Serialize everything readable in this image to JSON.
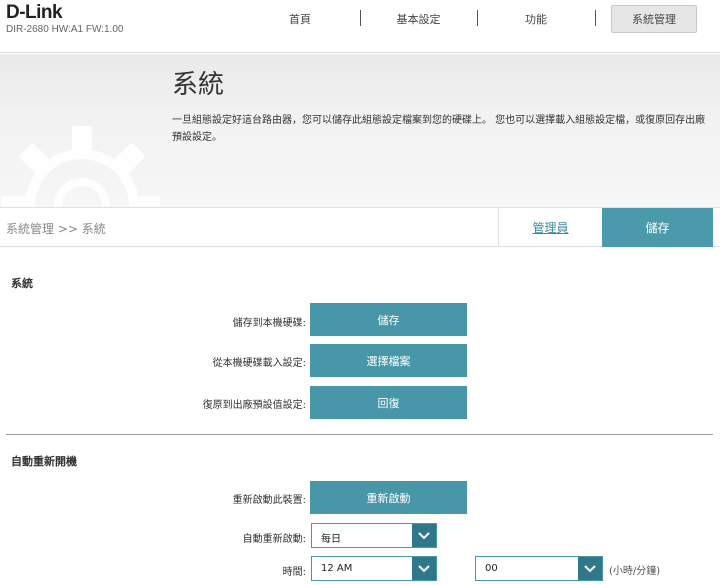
{
  "header": {
    "logo": "D-Link",
    "model": "DIR-2680 HW:A1 FW:1.00",
    "nav": [
      "首頁",
      "基本設定",
      "功能",
      "系統管理"
    ]
  },
  "banner": {
    "title": "系統",
    "description": "一旦組態設定好這台路由器，您可以儲存此組態設定檔案到您的硬碟上。 您也可以選擇載入組態設定檔，或復原回存出廠預設設定。"
  },
  "breadcrumb": "系統管理 >> 系統",
  "tabs": {
    "admin": "管理員",
    "save": "儲存"
  },
  "system": {
    "title": "系統",
    "save_label": "儲存到本機硬碟:",
    "save_button": "儲存",
    "load_label": "從本機硬碟載入設定:",
    "load_button": "選擇檔案",
    "restore_label": "復原到出廠預設值設定:",
    "restore_button": "回復"
  },
  "reboot": {
    "title": "自動重新開機",
    "reboot_label": "重新啟動此裝置:",
    "reboot_button": "重新啟動",
    "auto_label": "自動重新啟動:",
    "auto_value": "每日",
    "time_label": "時間:",
    "hour_value": "12 AM",
    "minute_value": "00",
    "unit": "(小時/分鐘)"
  },
  "colors": {
    "accent": "#4797a8",
    "accent_dark": "#2f7789"
  }
}
